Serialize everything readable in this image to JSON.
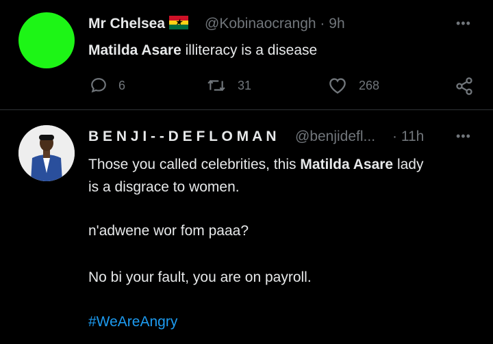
{
  "tweet1": {
    "name": "Mr Chelsea",
    "handle": "@Kobinaocrangh · 9h",
    "text_bold": "Matilda Asare",
    "text_rest": " illiteracy is a disease",
    "replies": "6",
    "retweets": "31",
    "likes": "268",
    "avatar_color": "#1df516",
    "flag_icon": "ghana-flag-icon"
  },
  "tweet2": {
    "name": "B E N J I - - D E F L O M A N",
    "handle": "@benjidefl...",
    "time": "· 11h",
    "line1_pre": "Those you called celebrities, this ",
    "line1_bold": "Matilda Asare",
    "line1_post": " lady",
    "line2": "is a disgrace to women.",
    "line3": "n'adwene wor fom paaa?",
    "line4": "No bi your fault, you are on payroll.",
    "hashtag": "#WeAreAngry"
  },
  "colors": {
    "background": "#000000",
    "muted": "#71767b",
    "hashtag": "#1d9bf0"
  }
}
